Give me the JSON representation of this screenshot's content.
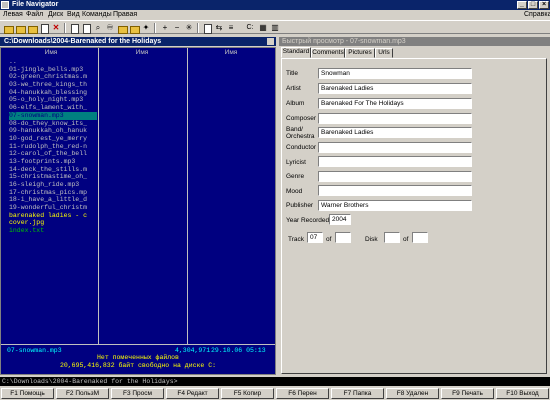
{
  "window": {
    "title": "File Navigator"
  },
  "menu": {
    "items": [
      "Левая",
      "Файл",
      "Диск",
      "Вид",
      "Команды",
      "Правая"
    ],
    "help": "Справка"
  },
  "toolbar": {
    "drive_label": "C:"
  },
  "left_panel": {
    "path": "C:\\Downloads\\2004-Barenaked for the Holidays",
    "columns": [
      "Имя",
      "Имя",
      "Имя"
    ],
    "files": [
      "..",
      "01-jingle_bells.mp3",
      "02-green_christmas.m",
      "03-we_three_kings_th",
      "04-hanukkah_blessing",
      "05-o_holy_night.mp3",
      "06-elfs_lament_with_",
      "07-snowman.mp3",
      "08-do_they_know_its_",
      "09-hanukkah_oh_hanuk",
      "10-god_rest_ye_merry",
      "11-rudolph_the_red-n",
      "12-carol_of_the_bell",
      "13-footprints.mp3",
      "14-deck_the_stills.m",
      "15-christmastime_oh_",
      "16-sleigh_ride.mp3",
      "17-christmas_pics.mp",
      "18-i_have_a_little_d",
      "19-wonderful_christm",
      "barenaked ladies - c",
      "cover.jpg",
      "index.txt"
    ],
    "status": {
      "name": "07-snowman.mp3",
      "size": "4,304,971",
      "date": "29.10.06 05:13"
    },
    "selection_info": "Нет помеченных файлов",
    "free_space": "20,695,416,832 байт свободно на диске C:"
  },
  "right_panel": {
    "header": "Быстрый просмотр - 07-snowman.mp3",
    "tabs": [
      "Standard",
      "Comments",
      "Pictures",
      "Urls"
    ],
    "fields": {
      "title": {
        "label": "Title",
        "value": "Snowman"
      },
      "artist": {
        "label": "Artist",
        "value": "Barenaked Ladies"
      },
      "album": {
        "label": "Album",
        "value": "Barenaked For The Holidays"
      },
      "composer": {
        "label": "Composer",
        "value": ""
      },
      "band": {
        "label": "Band/ Orchestra",
        "value": "Barenaked Ladies"
      },
      "conductor": {
        "label": "Conductor",
        "value": ""
      },
      "lyricist": {
        "label": "Lyricist",
        "value": ""
      },
      "genre": {
        "label": "Genre",
        "value": ""
      },
      "mood": {
        "label": "Mood",
        "value": ""
      },
      "publisher": {
        "label": "Publisher",
        "value": "Warner Brothers"
      }
    },
    "year": {
      "label": "Year Recorded",
      "value": "2004"
    },
    "track": {
      "label": "Track",
      "value": "07",
      "of_label": "of",
      "of_value": ""
    },
    "disk": {
      "label": "Disk",
      "value": "",
      "of_label": "of",
      "of_value": ""
    }
  },
  "command_line": "C:\\Downloads\\2004-Barenaked for the Holidays>",
  "function_keys": [
    "F1 Помощь",
    "F2 ПользМ",
    "F3 Просм",
    "F4 Редакт",
    "F5 Копир",
    "F6 Перен",
    "F7 Папка",
    "F8 Удален",
    "F9 Печать",
    "F10 Выход"
  ],
  "colors": {
    "panel_bg": "#000080",
    "panel_text": "#c0c0c0",
    "selected_bg": "#008080",
    "title_bar": "#0a246a",
    "status_text": "#00ffff",
    "info_text": "#ffff00"
  }
}
